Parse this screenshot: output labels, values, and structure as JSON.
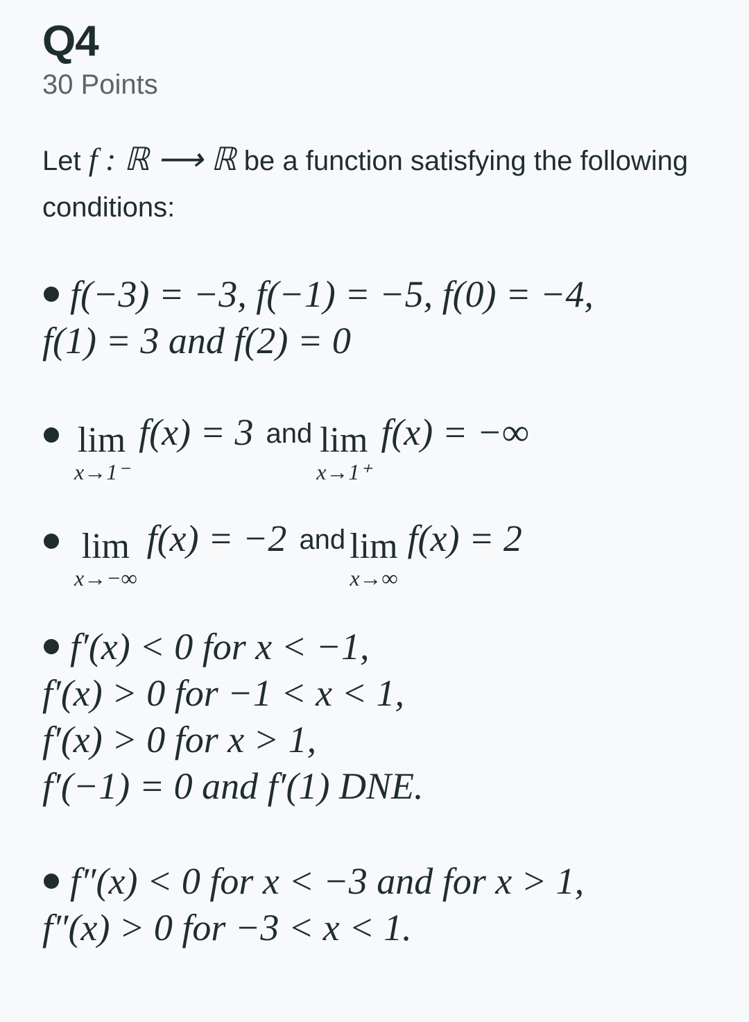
{
  "header": {
    "title": "Q4",
    "points": "30 Points"
  },
  "intro": {
    "text_before": "Let ",
    "fn_sig": "f : ℝ ⟶ ℝ",
    "text_after": " be a function satisfying the following conditions:"
  },
  "conditions": [
    {
      "lines": [
        "f(−3) = −3,  f(−1) = −5,  f(0) = −4,",
        "f(1) = 3 and f(2) = 0"
      ]
    },
    {
      "limits": [
        {
          "sub": "x→1⁻",
          "expr": "f(x) = 3"
        },
        {
          "sub": "x→1⁺",
          "expr": "f(x) = −∞"
        }
      ],
      "joiner": "and"
    },
    {
      "limits": [
        {
          "sub": "x→−∞",
          "expr": "f(x) = −2"
        },
        {
          "sub": "x→∞",
          "expr": "f(x) = 2"
        }
      ],
      "joiner": "and"
    },
    {
      "lines": [
        "f′(x) < 0 for x < −1,",
        "f′(x) > 0 for −1 < x < 1,",
        "f′(x) > 0 for x > 1,",
        "f′(−1) = 0 and f′(1) DNE."
      ]
    },
    {
      "lines": [
        "f″(x) < 0 for x < −3 and for x > 1,",
        "f″(x) > 0 for −3 < x < 1."
      ]
    }
  ],
  "lim_label": "lim"
}
